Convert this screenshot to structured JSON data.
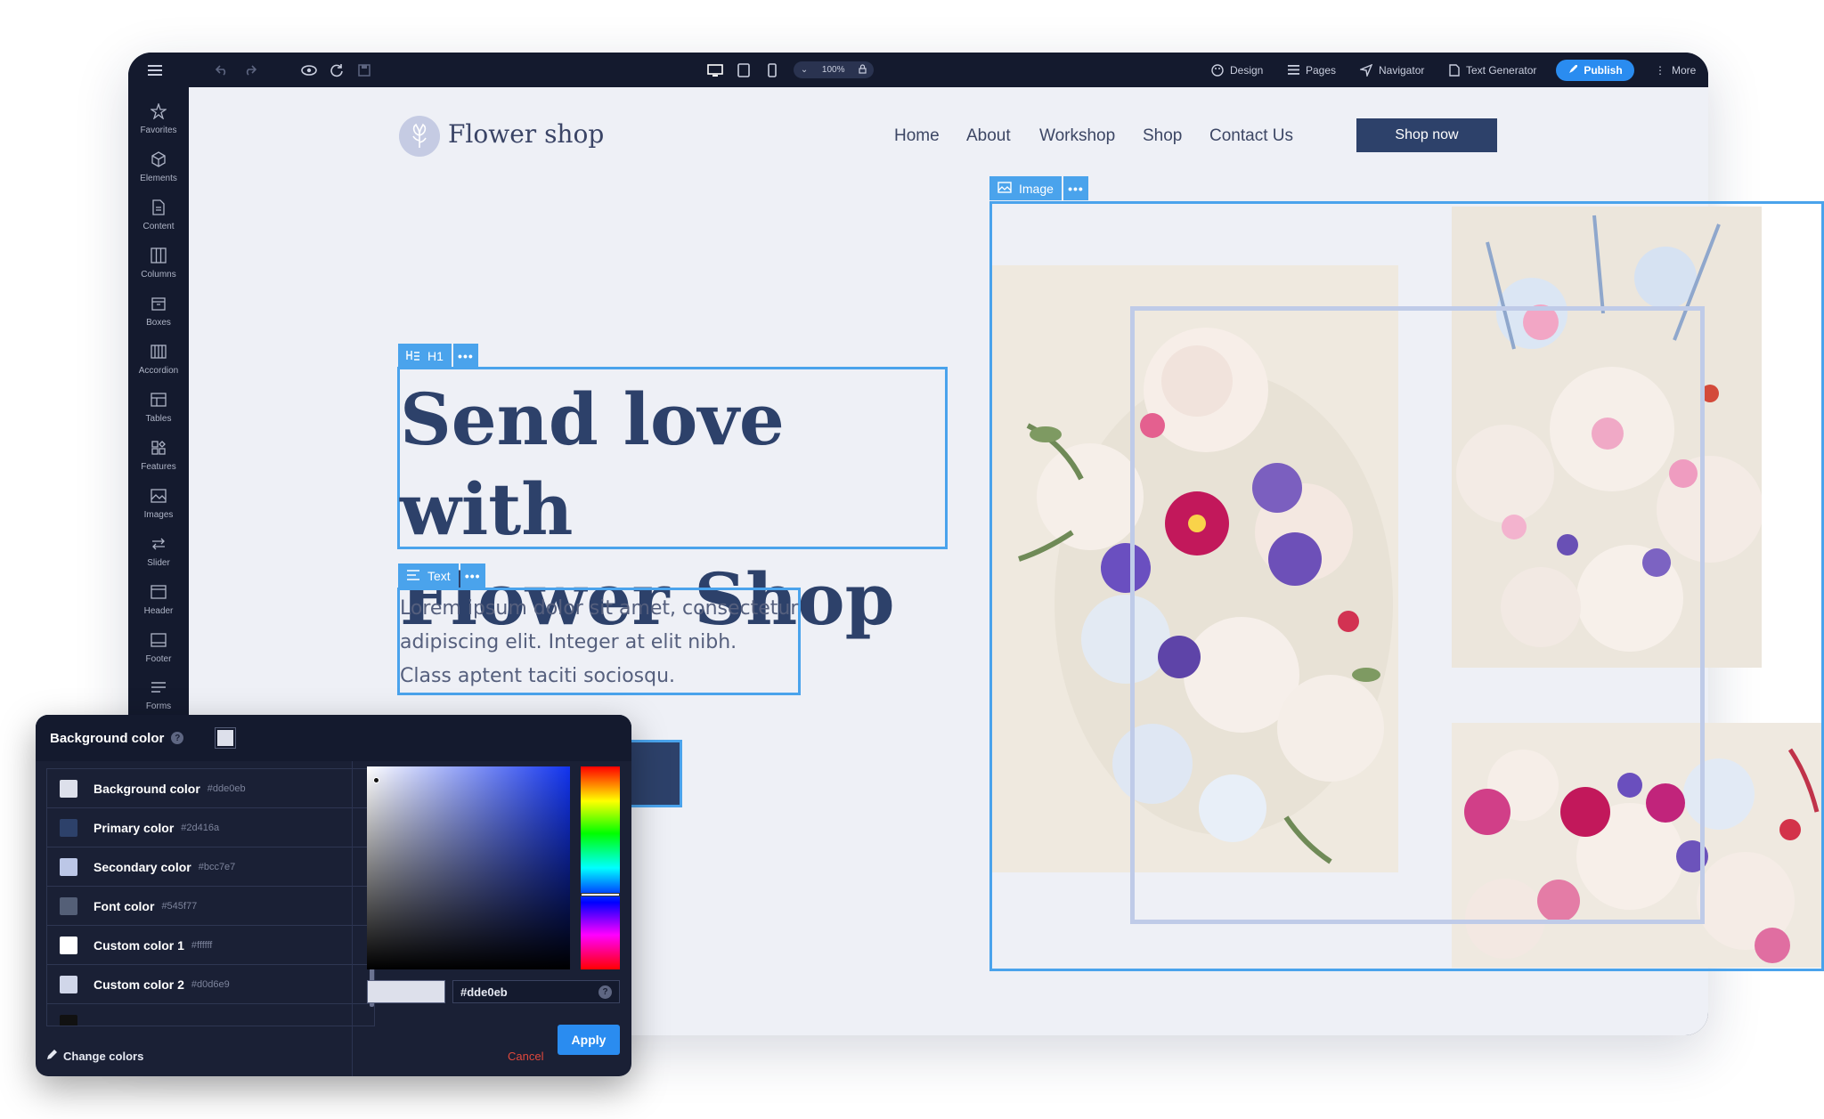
{
  "topbar": {
    "zoom": "100%",
    "menu": [
      {
        "label": "Design",
        "icon": "palette-icon"
      },
      {
        "label": "Pages",
        "icon": "list-icon"
      },
      {
        "label": "Navigator",
        "icon": "navigator-icon"
      },
      {
        "label": "Text Generator",
        "icon": "document-icon"
      }
    ],
    "publish_label": "Publish",
    "more_label": "More"
  },
  "sidebar": {
    "items": [
      {
        "label": "Favorites",
        "icon": "star-icon"
      },
      {
        "label": "Elements",
        "icon": "cube-icon"
      },
      {
        "label": "Content",
        "icon": "document-icon"
      },
      {
        "label": "Columns",
        "icon": "columns-icon"
      },
      {
        "label": "Boxes",
        "icon": "box-icon"
      },
      {
        "label": "Accordion",
        "icon": "accordion-icon"
      },
      {
        "label": "Tables",
        "icon": "table-icon"
      },
      {
        "label": "Features",
        "icon": "features-icon"
      },
      {
        "label": "Images",
        "icon": "image-icon"
      },
      {
        "label": "Slider",
        "icon": "slider-icon"
      },
      {
        "label": "Header",
        "icon": "header-icon"
      },
      {
        "label": "Footer",
        "icon": "footer-icon"
      },
      {
        "label": "Forms",
        "icon": "forms-icon"
      }
    ]
  },
  "site": {
    "brand": "Flower shop",
    "nav": [
      "Home",
      "About",
      "Workshop",
      "Shop",
      "Contact Us"
    ],
    "cta": "Shop now",
    "headline_line1": "Send love with",
    "headline_line2": "Flower Shop",
    "paragraph_line1": "Lorem ipsum dolor sit amet, consectetur",
    "paragraph_line2": "adipiscing elit. Integer at elit nibh.",
    "paragraph_line3": "Class aptent taciti sociosqu."
  },
  "selection_tags": {
    "h1": "H1",
    "text": "Text",
    "image": "Image"
  },
  "color_picker": {
    "title": "Background color",
    "swatches": [
      {
        "name": "Background color",
        "hex": "#dde0eb"
      },
      {
        "name": "Primary color",
        "hex": "#2d416a"
      },
      {
        "name": "Secondary color",
        "hex": "#bcc7e7"
      },
      {
        "name": "Font color",
        "hex": "#545f77"
      },
      {
        "name": "Custom color 1",
        "hex": "#ffffff"
      },
      {
        "name": "Custom color 2",
        "hex": "#d0d6e9"
      }
    ],
    "hex_value": "#dde0eb",
    "change_colors_label": "Change colors",
    "cancel_label": "Cancel",
    "apply_label": "Apply"
  },
  "colors": {
    "accent": "#4aa3ec",
    "primary": "#2d416a",
    "publish": "#2a8cf0",
    "cancel": "#e0483c"
  }
}
